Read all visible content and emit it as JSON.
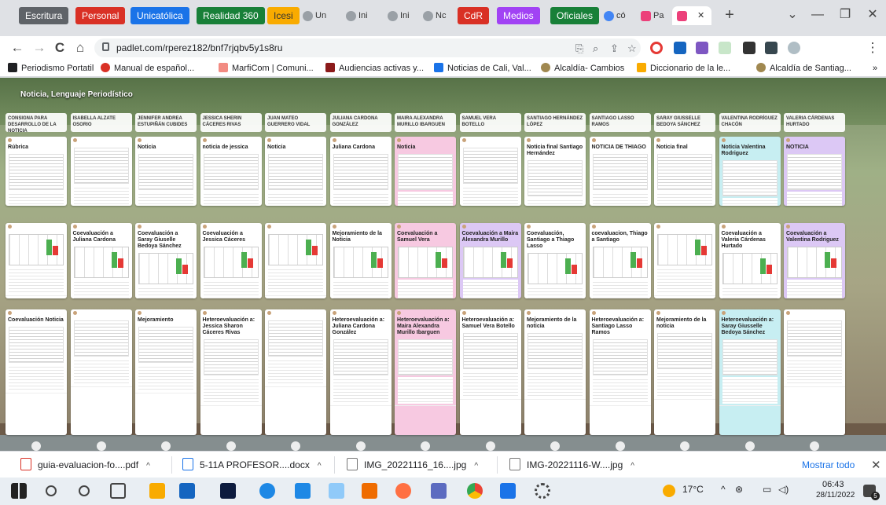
{
  "tabs": {
    "groups": [
      {
        "label": "Escritura",
        "color": "#5f6368"
      },
      {
        "label": "Personal",
        "color": "#d93025"
      },
      {
        "label": "Unicatólica",
        "color": "#1a73e8"
      },
      {
        "label": "Realidad 360",
        "color": "#188038"
      },
      {
        "label": "Icesi",
        "color": "#f9ab00"
      },
      {
        "label": "CdR",
        "color": "#d93025"
      },
      {
        "label": "Medios",
        "color": "#a142f4"
      },
      {
        "label": "Oficiales",
        "color": "#188038"
      }
    ],
    "items": [
      {
        "label": "Un",
        "icon": "chrome-tab-icon"
      },
      {
        "label": "Ini",
        "icon": "chrome-tab-icon"
      },
      {
        "label": "Ini",
        "icon": "chrome-tab-icon"
      },
      {
        "label": "Nc",
        "icon": "chrome-tab-icon"
      },
      {
        "label": "có",
        "icon": "google-tab-icon"
      },
      {
        "label": "Pa",
        "icon": "padlet-tab-icon"
      }
    ],
    "new_tab": "+",
    "window": {
      "minimize": "—",
      "maximize": "❐",
      "close": "✕",
      "tab_search": "⌄"
    }
  },
  "address": {
    "back": "←",
    "forward": "→",
    "reload": "C",
    "home": "⌂",
    "url": "padlet.com/rperez182/bnf7rjqbv5y1s8ru"
  },
  "bookmarks": [
    {
      "label": "Periodismo Portatil",
      "color": "#202124"
    },
    {
      "label": "Manual de español...",
      "color": "#d93025"
    },
    {
      "label": "MarfiCom | Comuni...",
      "color": "#f28b82"
    },
    {
      "label": "Audiencias activas y...",
      "color": "#8b1a1a"
    },
    {
      "label": "Noticias de Cali, Val...",
      "color": "#1a73e8"
    },
    {
      "label": "Alcaldía- Cambios",
      "color": "#a08850"
    },
    {
      "label": "Diccionario de la le...",
      "color": "#f9ab00"
    },
    {
      "label": "Alcaldía de Santiag...",
      "color": "#a08850"
    }
  ],
  "board": {
    "title": "Noticia, Lenguaje Periodístico",
    "columns": [
      {
        "header": "Consigna para desarrollo de la noticia",
        "posts": [
          "Rúbrica",
          "",
          "Coevaluación Noticia"
        ]
      },
      {
        "header": "ISABELLA ALZATE OSORIO",
        "posts": [
          "",
          "Coevaluación a Juliana Cardona",
          ""
        ]
      },
      {
        "header": "JENNIFER ANDREA ESTUPIÑÁN CUBIDES",
        "posts": [
          "Noticia",
          "Coevaluación a Saray Giuselle Bedoya Sánchez",
          "Mejoramiento"
        ]
      },
      {
        "header": "JESSICA SHERIN CÁCERES RIVAS",
        "posts": [
          "noticia de jessica",
          "Coevaluación a Jessica Cáceres",
          "Heteroevaluación a: Jessica Sharon Cáceres Rivas"
        ]
      },
      {
        "header": "JUAN MATEO GUERRERO VIDAL",
        "posts": [
          "Noticia",
          "",
          ""
        ]
      },
      {
        "header": "JULIANA CARDONA GONZÁLEZ",
        "posts": [
          "Juliana Cardona",
          "Mejoramiento de la Noticia",
          "Heteroevaluación a: Juliana Cardona González"
        ]
      },
      {
        "header": "MAIRA ALEXANDRA MURILLO IBARGUEN",
        "posts": [
          "Noticia",
          "Coevaluación a Samuel Vera",
          "Heteroevaluación a: Maira Alexandra Murillo Ibarguen"
        ]
      },
      {
        "header": "SAMUEL VERA BOTELLO",
        "posts": [
          "",
          "Coevaluación a Maira Alexandra Murillo",
          "Heteroevaluación a: Samuel Vera Botello"
        ]
      },
      {
        "header": "SANTIAGO HERNÁNDEZ LÓPEZ",
        "posts": [
          "Noticia final Santiago Hernández",
          "Coevaluación, Santiago a Thiago Lasso",
          "Mejoramiento de la noticia"
        ]
      },
      {
        "header": "SANTIAGO LASSO RAMOS",
        "posts": [
          "NOTICIA DE THIAGO",
          "coevaluacion, Thiago a Santiago",
          "Heteroevaluación a: Santiago Lasso Ramos"
        ]
      },
      {
        "header": "SARAY GIUSSELLE BEDOYA SÁNCHEZ",
        "posts": [
          "Noticia final",
          "",
          "Mejoramiento de la noticia"
        ]
      },
      {
        "header": "VALENTINA RODRÍGUEZ CHACÓN",
        "posts": [
          "Noticia Valentina Rodriguez",
          "Coevaluación a Valeria Cárdenas Hurtado",
          "Heteroevaluación a: Saray Giusselle Bedoya Sánchez"
        ]
      },
      {
        "header": "VALERIA CÁRDENAS HURTADO",
        "posts": [
          "NOTICIA",
          "Coevaluación a Valentina Rodriguez",
          ""
        ]
      }
    ]
  },
  "downloads": {
    "items": [
      {
        "label": "guia-evaluacion-fo....pdf",
        "icon": "pdf-file-icon"
      },
      {
        "label": "5-11A PROFESOR....docx",
        "icon": "word-file-icon"
      },
      {
        "label": "IMG_20221116_16....jpg",
        "icon": "image-file-icon"
      },
      {
        "label": "IMG-20221116-W....jpg",
        "icon": "image-file-icon"
      }
    ],
    "show_all": "Mostrar todo",
    "close": "✕"
  },
  "taskbar": {
    "temperature": "17°C",
    "time": "06:43",
    "date": "28/11/2022",
    "notifications": "5"
  }
}
